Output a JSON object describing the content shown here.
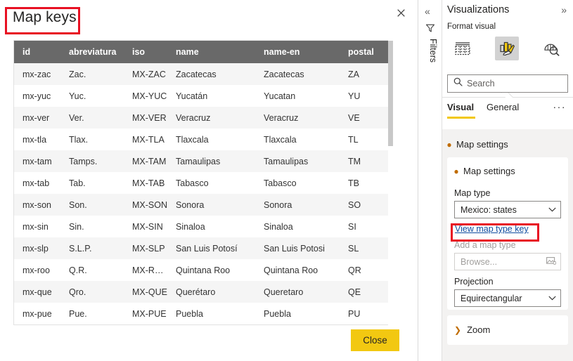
{
  "dialog": {
    "title": "Map keys",
    "close_icon": "close-icon",
    "close_button_label": "Close",
    "columns": [
      "id",
      "abreviatura",
      "iso",
      "name",
      "name-en",
      "postal"
    ],
    "rows": [
      [
        "mx-zac",
        "Zac.",
        "MX-ZAC",
        "Zacatecas",
        "Zacatecas",
        "ZA"
      ],
      [
        "mx-yuc",
        "Yuc.",
        "MX-YUC",
        "Yucatán",
        "Yucatan",
        "YU"
      ],
      [
        "mx-ver",
        "Ver.",
        "MX-VER",
        "Veracruz",
        "Veracruz",
        "VE"
      ],
      [
        "mx-tla",
        "Tlax.",
        "MX-TLA",
        "Tlaxcala",
        "Tlaxcala",
        "TL"
      ],
      [
        "mx-tam",
        "Tamps.",
        "MX-TAM",
        "Tamaulipas",
        "Tamaulipas",
        "TM"
      ],
      [
        "mx-tab",
        "Tab.",
        "MX-TAB",
        "Tabasco",
        "Tabasco",
        "TB"
      ],
      [
        "mx-son",
        "Son.",
        "MX-SON",
        "Sonora",
        "Sonora",
        "SO"
      ],
      [
        "mx-sin",
        "Sin.",
        "MX-SIN",
        "Sinaloa",
        "Sinaloa",
        "SI"
      ],
      [
        "mx-slp",
        "S.L.P.",
        "MX-SLP",
        "San Luis Potosí",
        "San Luis Potosi",
        "SL"
      ],
      [
        "mx-roo",
        "Q.R.",
        "MX-ROO",
        "Quintana Roo",
        "Quintana Roo",
        "QR"
      ],
      [
        "mx-que",
        "Qro.",
        "MX-QUE",
        "Querétaro",
        "Queretaro",
        "QE"
      ],
      [
        "mx-pue",
        "Pue.",
        "MX-PUE",
        "Puebla",
        "Puebla",
        "PU"
      ]
    ]
  },
  "filters_rail": {
    "collapse_icon": "chevron-double-left-icon",
    "collapse_glyph": "«",
    "funnel_icon": "filter-funnel-icon",
    "label": "Filters"
  },
  "visualizations": {
    "title": "Visualizations",
    "expand_icon": "chevron-double-right-icon",
    "expand_glyph": "»",
    "format_visual_label": "Format visual",
    "icons": [
      {
        "name": "build-visual-fields-icon",
        "selected": false
      },
      {
        "name": "format-visual-paintbrush-icon",
        "selected": true
      },
      {
        "name": "analytics-magnifier-icon",
        "selected": false
      }
    ],
    "search": {
      "placeholder": "Search",
      "value": "",
      "icon": "search-icon"
    },
    "tabs": [
      {
        "label": "Visual",
        "active": true
      },
      {
        "label": "General",
        "active": false
      }
    ],
    "more_options_glyph": "···",
    "group_title": "Map settings",
    "card": {
      "title": "Map settings",
      "map_type_label": "Map type",
      "map_type_value": "Mexico: states",
      "view_map_type_key_link": "View map type key",
      "add_map_type_label": "Add a map type",
      "browse_placeholder": "Browse...",
      "browse_icon": "upload-image-icon",
      "projection_label": "Projection",
      "projection_value": "Equirectangular",
      "chevron_down_glyph": "⌄"
    },
    "zoom_card": {
      "title": "Zoom",
      "collapsed": true
    }
  },
  "colors": {
    "accent_yellow": "#f2c811",
    "highlight_red": "#e81123",
    "table_header_bg": "#696969",
    "link_blue": "#0f4c9f",
    "panel_bg": "#f3f2f1"
  }
}
